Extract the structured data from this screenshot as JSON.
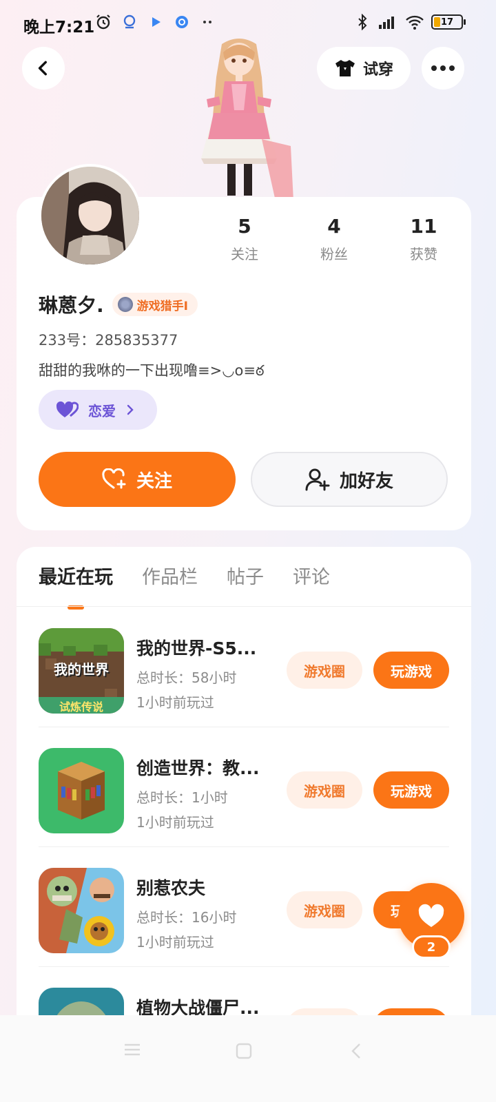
{
  "status_bar": {
    "time": "晚上7:21",
    "battery": "17"
  },
  "header": {
    "try_on_label": "试穿"
  },
  "profile": {
    "stats": [
      {
        "value": "5",
        "label": "关注"
      },
      {
        "value": "4",
        "label": "粉丝"
      },
      {
        "value": "11",
        "label": "获赞"
      }
    ],
    "username": "琳蒽夕.",
    "badge": "游戏猎手Ⅰ",
    "uid": "233号：285835377",
    "bio": "甜甜的我咻的一下出现噜≡>◡o≡ఠ",
    "love_tag": "恋爱",
    "follow_label": "关注",
    "add_friend_label": "加好友"
  },
  "tabs": [
    {
      "label": "最近在玩",
      "active": true
    },
    {
      "label": "作品栏",
      "active": false
    },
    {
      "label": "帖子",
      "active": false
    },
    {
      "label": "评论",
      "active": false
    }
  ],
  "games": [
    {
      "name": "我的世界-S5...",
      "time": "总时长：58小时",
      "last": "1小时前玩过",
      "circle": "游戏圈",
      "play": "玩游戏",
      "icon": "minecraft-icon",
      "icon_text": "我的世界",
      "icon_sub": "试炼传说"
    },
    {
      "name": "创造世界：教...",
      "time": "总时长：1小时",
      "last": "1小时前玩过",
      "circle": "游戏圈",
      "play": "玩游戏",
      "icon": "bookshelf-icon"
    },
    {
      "name": "别惹农夫",
      "time": "总时长：16小时",
      "last": "1小时前玩过",
      "circle": "游戏圈",
      "play": "玩游戏",
      "icon": "farmer-game-icon"
    },
    {
      "name": "植物大战僵尸...",
      "time": "",
      "last": "",
      "circle": "",
      "play": "",
      "icon": "zombie-icon"
    }
  ],
  "like_fab": {
    "count": "2"
  },
  "colors": {
    "accent": "#fb7516",
    "accent_soft": "#fff0e7",
    "love": "#6c54d6"
  }
}
